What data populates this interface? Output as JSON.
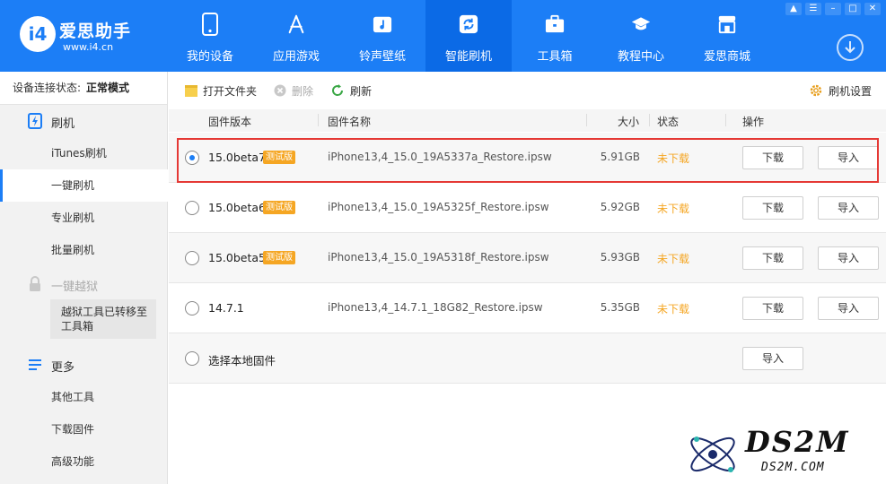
{
  "app": {
    "logo_mark": "i4",
    "name": "爱思助手",
    "url": "www.i4.cn"
  },
  "nav": [
    {
      "label": "我的设备",
      "icon": "phone-icon"
    },
    {
      "label": "应用游戏",
      "icon": "app-store-icon"
    },
    {
      "label": "铃声壁纸",
      "icon": "music-icon"
    },
    {
      "label": "智能刷机",
      "icon": "refresh-icon",
      "active": true
    },
    {
      "label": "工具箱",
      "icon": "toolbox-icon"
    },
    {
      "label": "教程中心",
      "icon": "graduation-cap-icon"
    },
    {
      "label": "爱思商城",
      "icon": "shop-icon"
    }
  ],
  "sidebar": {
    "conn_label": "设备连接状态:",
    "conn_value": "正常模式",
    "group_flash": "刷机",
    "items_flash": [
      "iTunes刷机",
      "一键刷机",
      "专业刷机",
      "批量刷机"
    ],
    "active_item": "一键刷机",
    "group_jailbreak": "一键越狱",
    "jailbreak_note": "越狱工具已转移至工具箱",
    "group_more": "更多",
    "items_more": [
      "其他工具",
      "下载固件",
      "高级功能"
    ]
  },
  "toolbar": {
    "open_folder": "打开文件夹",
    "delete": "删除",
    "refresh": "刷新",
    "settings": "刷机设置"
  },
  "table": {
    "headers": {
      "version": "固件版本",
      "name": "固件名称",
      "size": "大小",
      "status": "状态",
      "action": "操作"
    },
    "beta_badge": "测试版",
    "download_label": "下载",
    "import_label": "导入",
    "rows": [
      {
        "version": "15.0beta7",
        "beta": true,
        "name": "iPhone13,4_15.0_19A5337a_Restore.ipsw",
        "size": "5.91GB",
        "status": "未下载",
        "selected": true
      },
      {
        "version": "15.0beta6",
        "beta": true,
        "name": "iPhone13,4_15.0_19A5325f_Restore.ipsw",
        "size": "5.92GB",
        "status": "未下载"
      },
      {
        "version": "15.0beta5",
        "beta": true,
        "name": "iPhone13,4_15.0_19A5318f_Restore.ipsw",
        "size": "5.93GB",
        "status": "未下载"
      },
      {
        "version": "14.7.1",
        "beta": false,
        "name": "iPhone13,4_14.7.1_18G82_Restore.ipsw",
        "size": "5.35GB",
        "status": "未下载"
      }
    ],
    "local_label": "选择本地固件"
  },
  "watermark": {
    "big": "DS2M",
    "small": "DS2M.COM"
  },
  "colors": {
    "brand": "#1c7ef6",
    "status_orange": "#f5a623",
    "highlight_red": "#e53935"
  }
}
